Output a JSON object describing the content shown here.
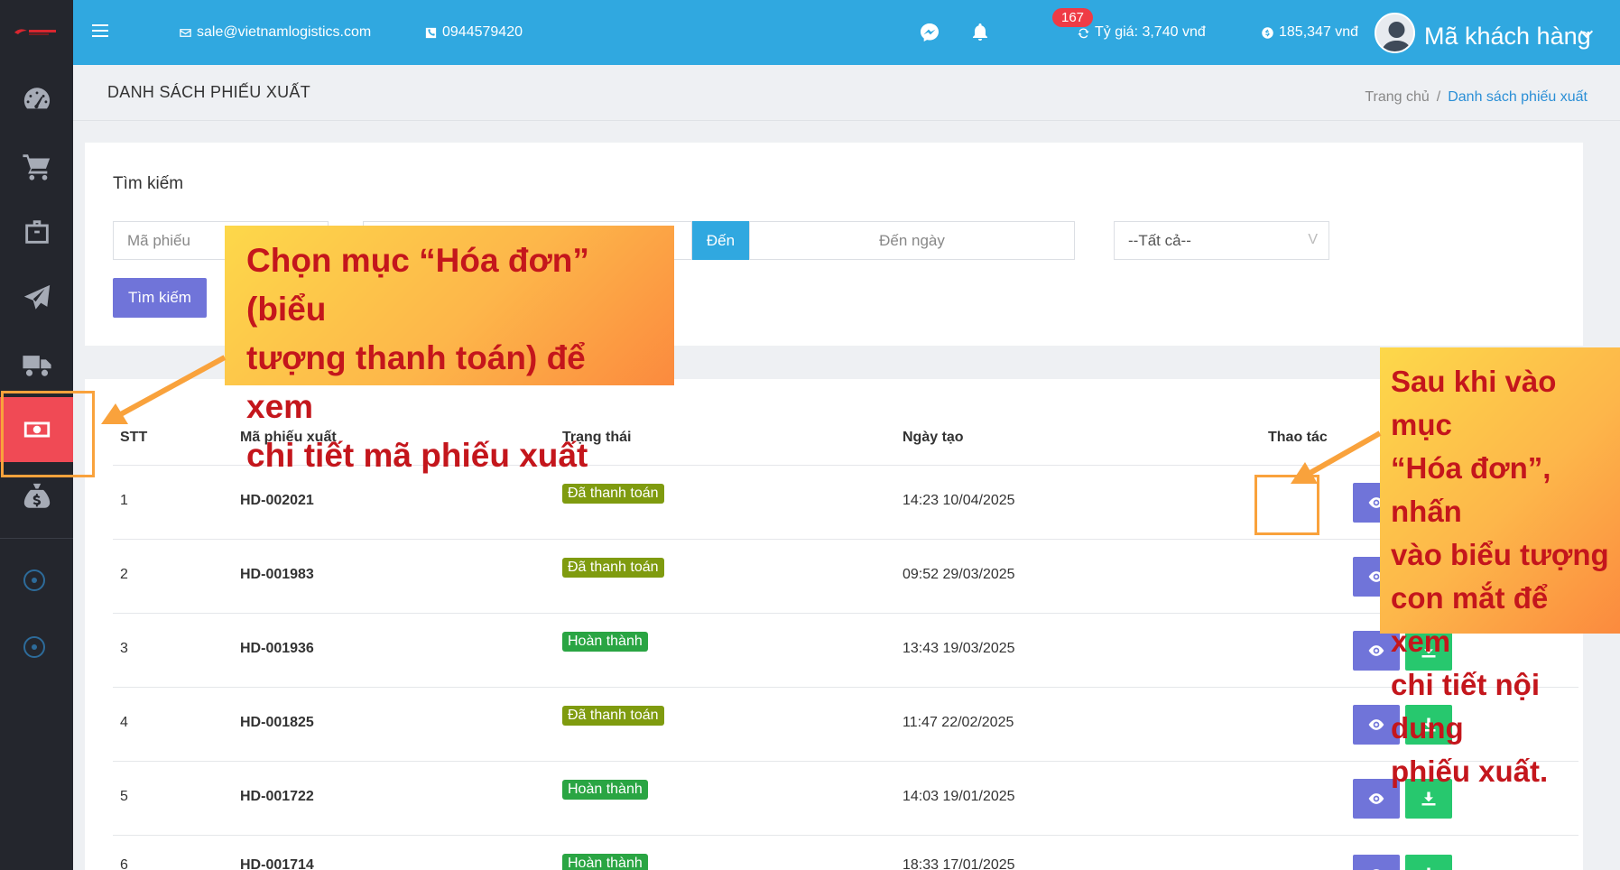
{
  "topbar": {
    "email": "sale@vietnamlogistics.com",
    "phone": "0944579420",
    "notification_count": "167",
    "exchange_rate": "Tỷ giá: 3,740 vnđ",
    "balance": "185,347 vnđ",
    "user_label": "Mã khách hàng"
  },
  "page": {
    "title": "DANH SÁCH PHIẾU XUẤT",
    "breadcrumb_home": "Trang chủ",
    "breadcrumb_sep": "/",
    "breadcrumb_current": "Danh sách phiếu xuất"
  },
  "search": {
    "title": "Tìm kiếm",
    "code_placeholder": "Mã phiếu",
    "to_label": "Đến",
    "to_date_placeholder": "Đến ngày",
    "status_select": "--Tất cả--",
    "select_caret": "V",
    "button": "Tìm kiếm"
  },
  "table": {
    "headers": {
      "stt": "STT",
      "code": "Mã phiếu xuất",
      "status": "Trạng thái",
      "date": "Ngày tạo",
      "actions": "Thao tác"
    },
    "rows": [
      {
        "stt": "1",
        "code": "HD-002021",
        "status": "Đã thanh toán",
        "status_type": "paid",
        "date": "14:23 10/04/2025"
      },
      {
        "stt": "2",
        "code": "HD-001983",
        "status": "Đã thanh toán",
        "status_type": "paid",
        "date": "09:52 29/03/2025"
      },
      {
        "stt": "3",
        "code": "HD-001936",
        "status": "Hoàn thành",
        "status_type": "done",
        "date": "13:43 19/03/2025"
      },
      {
        "stt": "4",
        "code": "HD-001825",
        "status": "Đã thanh toán",
        "status_type": "paid",
        "date": "11:47 22/02/2025"
      },
      {
        "stt": "5",
        "code": "HD-001722",
        "status": "Hoàn thành",
        "status_type": "done",
        "date": "14:03 19/01/2025"
      },
      {
        "stt": "6",
        "code": "HD-001714",
        "status": "Hoàn thành",
        "status_type": "done",
        "date": "18:33 17/01/2025"
      }
    ]
  },
  "annotations": {
    "callout_left": [
      "Chọn mục “Hóa đơn” (biểu",
      "tượng thanh toán) để xem",
      "chi tiết mã phiếu xuất"
    ],
    "callout_right": [
      "Sau khi vào mục",
      "“Hóa đơn”, nhấn",
      "vào biểu tượng",
      "con mắt để xem",
      "chi tiết nội dung",
      "phiếu xuất."
    ]
  },
  "colors": {
    "topbar": "#30a8e0",
    "sidebar": "#24262d",
    "active_item": "#f04a55",
    "status_paid": "#7f9b0f",
    "status_done": "#2aa543",
    "view_button": "#7074d9",
    "download_button": "#27c86e",
    "annotation_text": "#c4161c"
  },
  "icons": {
    "sidebar": [
      "dashboard-icon",
      "cart-icon",
      "bag-icon",
      "paper-plane-icon",
      "truck-icon",
      "invoice-money-icon",
      "money-bag-icon"
    ],
    "actions": [
      "eye-icon",
      "download-icon"
    ]
  }
}
